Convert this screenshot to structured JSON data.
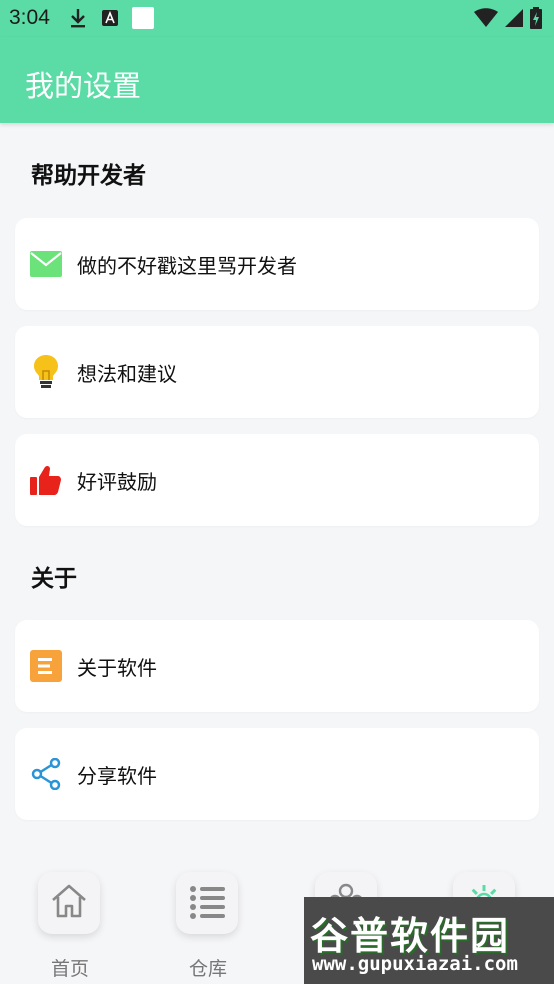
{
  "status_bar": {
    "time": "3:04",
    "left_icons": [
      "download-icon",
      "text-a-icon",
      "white-square-icon"
    ],
    "right_icons": [
      "wifi-icon",
      "signal-icon",
      "battery-charging-icon"
    ]
  },
  "app_bar": {
    "title": "我的设置",
    "color": "#5bdba5"
  },
  "sections": {
    "help": {
      "title": "帮助开发者",
      "items": [
        {
          "label": "做的不好戳这里骂开发者",
          "icon": "mail-icon",
          "color": "#6ce27a"
        },
        {
          "label": "想法和建议",
          "icon": "lightbulb-icon",
          "color": "#f6c21a"
        },
        {
          "label": "好评鼓励",
          "icon": "thumbs-up-icon",
          "color": "#e8231c"
        }
      ]
    },
    "about": {
      "title": "关于",
      "items": [
        {
          "label": "关于软件",
          "icon": "document-icon",
          "color": "#f7a23b"
        },
        {
          "label": "分享软件",
          "icon": "share-icon",
          "color": "#2a95d6"
        }
      ]
    }
  },
  "bottom_nav": {
    "items": [
      {
        "label": "首页",
        "icon": "home-icon"
      },
      {
        "label": "仓库",
        "icon": "list-icon"
      },
      {
        "label": "",
        "icon": "people-icon"
      },
      {
        "label": "",
        "icon": "settings-gear-icon"
      }
    ]
  },
  "watermark": {
    "text": "谷普软件园",
    "url": "www.gupuxiazai.com"
  }
}
